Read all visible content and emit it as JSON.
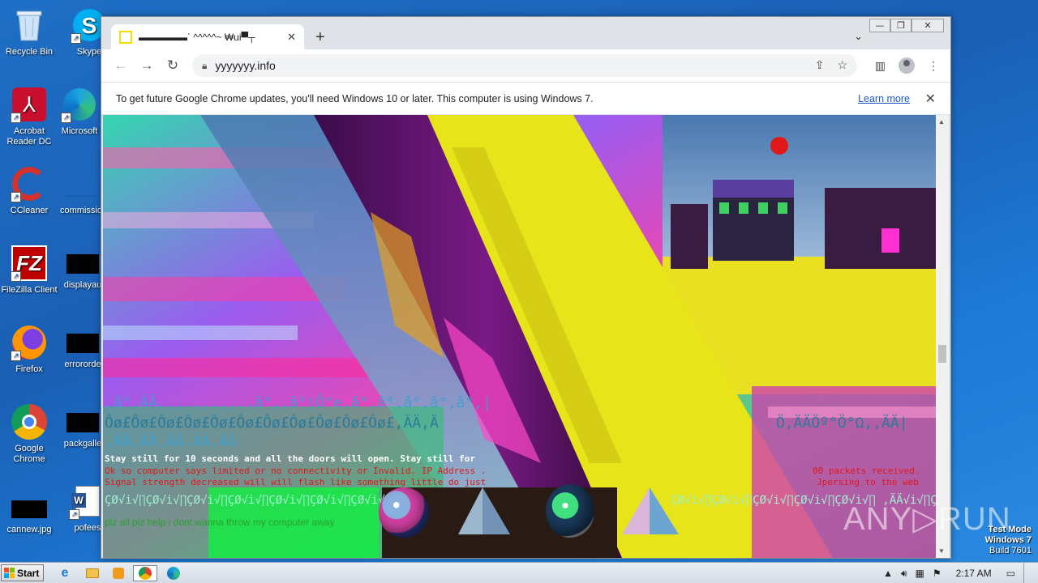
{
  "desktop": {
    "icons": [
      {
        "label": "Recycle Bin"
      },
      {
        "label": "Skype"
      },
      {
        "label": "Acrobat Reader DC"
      },
      {
        "label": "Microsoft"
      },
      {
        "label": "CCleaner"
      },
      {
        "label": "commissio"
      },
      {
        "label": "FileZilla Client"
      },
      {
        "label": "displayau"
      },
      {
        "label": "Firefox"
      },
      {
        "label": "errororde"
      },
      {
        "label": "Google Chrome"
      },
      {
        "label": "packgalle"
      },
      {
        "label": "cannew.jpg"
      },
      {
        "label": "pofees"
      }
    ]
  },
  "browser": {
    "tab_title": "▬▬▬▬▬` ^^^^^~ ₩ui▀┬",
    "tab_close": "✕",
    "new_tab": "+",
    "tab_menu": "⌄",
    "window_buttons": {
      "minimize": "—",
      "restore": "❐",
      "close": "✕"
    },
    "nav": {
      "back": "←",
      "forward": "→",
      "reload": "↻"
    },
    "url": "yyyyyyy.info",
    "infobar": {
      "message": "To get future Google Chrome updates, you'll need Windows 10 or later. This computer is using Windows 7.",
      "link": "Learn more",
      "close": "✕"
    }
  },
  "page": {
    "garble_line1": ",â°,ÄÄ,,,,,,,,,,,â°,,â°|Ô°e,â°,â°,â°,â°,â°,|",
    "garble_line2": "Ôø£Ôø£Ôø£Ôø£Ôø£Ôø£Ôø£Ôø£Ôø£Ôø£Ôø£,ÄÄ,Ä",
    "garble_line2_right": "Ö,ÄÄÖº°Ö°Ω,,ÄÄ|",
    "garble_line3": ",ÄÄ,ÄÄ,ÄÄ,ÄÄ,ÄÄ",
    "stay_still": "Stay still for 10 seconds and all the doors will open. Stay still for",
    "red_line1": "Ok so computer says limited or no connectivity or Invalid. IP Address .",
    "red_line1_right": "00 packets received.",
    "red_line2": "Signal strength decreased will will flash like something little do just",
    "red_line2_right": "Jpersing to the web",
    "sqrt_line": "ÇØ√i√∏ÇØ√i√∏ÇØ√i√∏ÇØ√i√∏ÇØ√i√∏ÇØ√i√∏ÇØ√i√∏",
    "sqrt_line_right": "ÇØ√i√∏ÇØ√i√∏ÇØ√i√∏ÇØ√i√∏ÇØ√i√∏ ,ÄÄ√i√∏ÇØ",
    "plz": "plz all plz help i dont wanna throw my computer away"
  },
  "watermark": {
    "brand": "ANY▷RUN",
    "mode1": "Test Mode",
    "mode2": "Windows 7",
    "build": "Build 7601"
  },
  "taskbar": {
    "start_label": "Start",
    "clock": "2:17 AM"
  }
}
